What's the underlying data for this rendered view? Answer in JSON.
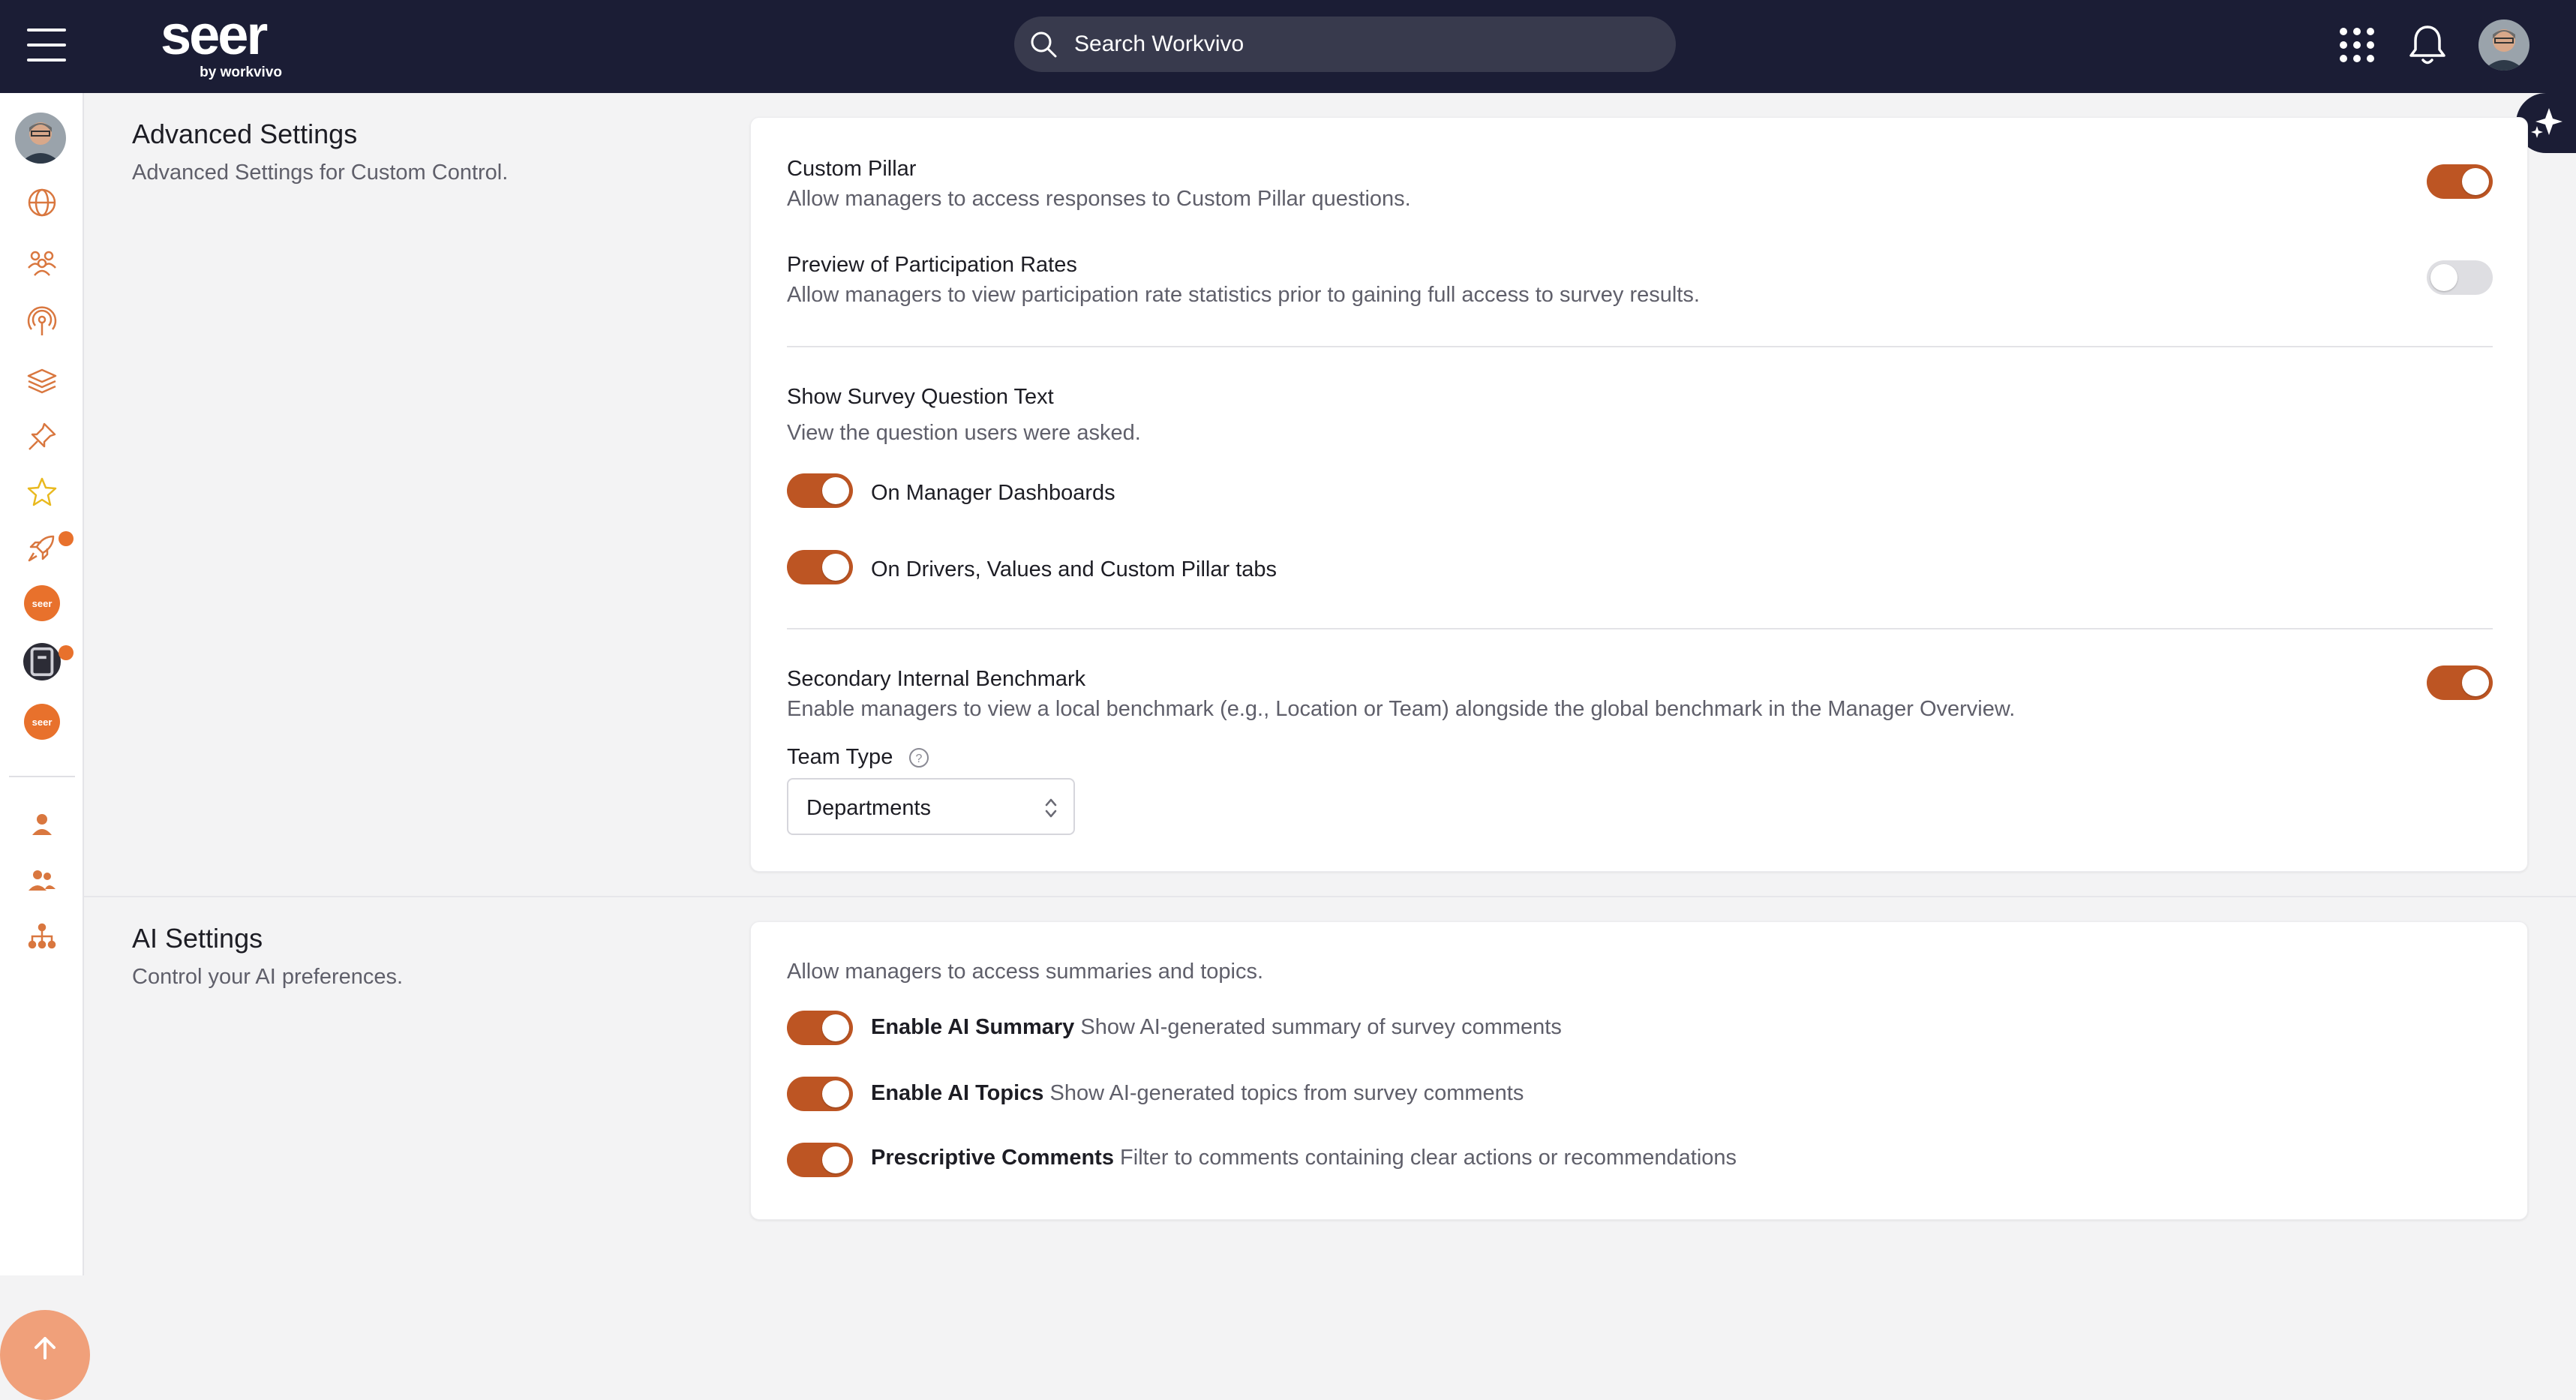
{
  "header": {
    "logo": "seer",
    "logo_sub": "by workvivo",
    "search_placeholder": "Search Workvivo"
  },
  "colors": {
    "nav_bg": "#1b1d35",
    "accent": "#bd5523",
    "badge_orange": "#e8712c",
    "icon_orange": "#d9773f"
  },
  "sidebar": {
    "items": [
      {
        "icon": "globe-icon"
      },
      {
        "icon": "people-group-icon"
      },
      {
        "icon": "podcast-icon"
      },
      {
        "icon": "layers-icon"
      },
      {
        "icon": "pin-icon"
      },
      {
        "icon": "star-icon"
      },
      {
        "icon": "rocket-icon"
      },
      {
        "icon": "seer-app-badge",
        "label": "seer"
      },
      {
        "icon": "dark-app-badge"
      },
      {
        "icon": "seer-app-badge",
        "label": "seer"
      },
      {
        "icon": "person-icon"
      },
      {
        "icon": "people-icon"
      },
      {
        "icon": "org-chart-icon"
      }
    ]
  },
  "advanced": {
    "title": "Advanced Settings",
    "description": "Advanced Settings for Custom Control.",
    "custom_pillar": {
      "title": "Custom Pillar",
      "description": "Allow managers to access responses to Custom Pillar questions.",
      "enabled": true
    },
    "participation": {
      "title": "Preview of Participation Rates",
      "description": "Allow managers to view participation rate statistics prior to gaining full access to survey results.",
      "enabled": false
    },
    "question_text": {
      "title": "Show Survey Question Text",
      "description": "View the question users were asked.",
      "on_manager_dashboards": "On Manager Dashboards",
      "on_drivers": "On Drivers, Values and Custom Pillar tabs"
    },
    "benchmark": {
      "title": "Secondary Internal Benchmark",
      "description": "Enable managers to view a local benchmark (e.g., Location or Team) alongside the global benchmark in the Manager Overview.",
      "enabled": true,
      "team_type_label": "Team Type",
      "team_type_value": "Departments"
    }
  },
  "ai": {
    "title": "AI Settings",
    "description": "Control your AI preferences.",
    "intro": "Allow managers to access summaries and topics.",
    "summary": {
      "label": "Enable AI Summary",
      "description": "Show AI-generated summary of survey comments"
    },
    "topics": {
      "label": "Enable AI Topics",
      "description": "Show AI-generated topics from survey comments"
    },
    "prescriptive": {
      "label": "Prescriptive Comments",
      "description": "Filter to comments containing clear actions or recommendations"
    }
  }
}
